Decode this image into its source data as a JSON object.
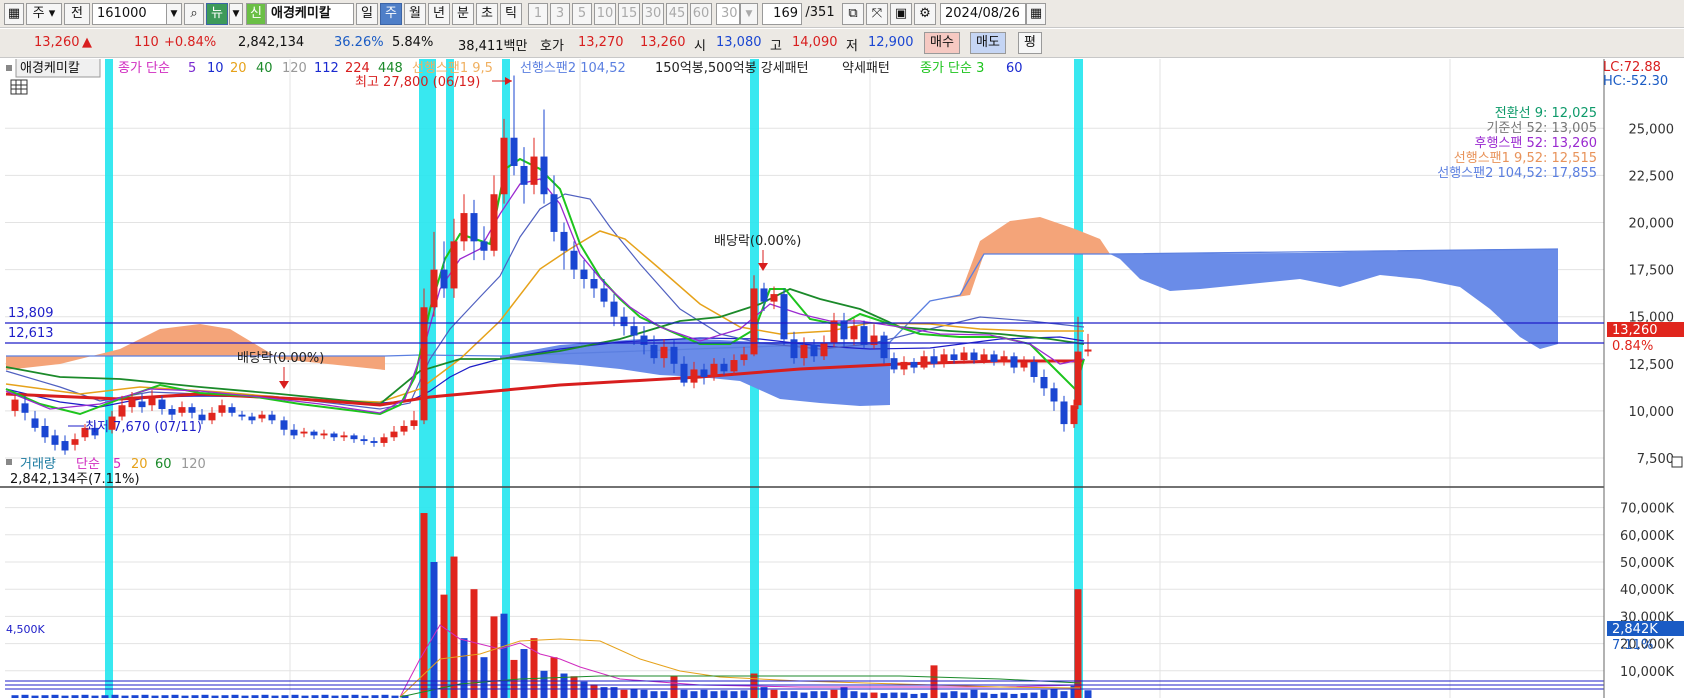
{
  "toolbar": {
    "market_label": "주",
    "prev_label": "전",
    "code": "161000",
    "news_label": "뉴",
    "credit_label": "신",
    "stock_name": "애경케미칼",
    "period_day": "일",
    "period_week": "주",
    "period_month": "월",
    "period_year": "년",
    "period_minute": "분",
    "period_second": "초",
    "period_tick": "틱",
    "intervals": [
      "1",
      "3",
      "5",
      "10",
      "15",
      "30",
      "45",
      "60"
    ],
    "interval_value": "30",
    "count_value": "169",
    "count_total": "/351",
    "date": "2024/08/26"
  },
  "quote": {
    "price": "13,260",
    "change_arrow": "▲",
    "change": "110",
    "change_pct": "+0.84%",
    "volume": "2,842,134",
    "ratio1": "36.26%",
    "ratio2": "5.84%",
    "trade_value": "38,411백만",
    "hoga_label": "호가",
    "ask": "13,270",
    "bid": "13,260",
    "open_label": "시",
    "open": "13,080",
    "high_label": "고",
    "high": "14,090",
    "low_label": "저",
    "low": "12,900",
    "buy_label": "매수",
    "sell_label": "매도",
    "eval_label": "평"
  },
  "price_panel": {
    "name": "애경케미칼",
    "ma_title": "종가 단순",
    "ma_periods": [
      "5",
      "10",
      "20",
      "40",
      "120",
      "112",
      "224",
      "448"
    ],
    "span1_label": "선행스팬1 9,5",
    "span2_label": "선행스팬2 104,52",
    "pattern_label": "150억봉,500억봉 강세패턴",
    "weak_label": "약세패턴",
    "ma3_label": "종가 단순 3",
    "ma3_extra": "60",
    "lc": "LC:72.88",
    "hc": "HC:-52.30",
    "legend": [
      {
        "text": "전환선 9: 12,025",
        "color": "#0e9a6a"
      },
      {
        "text": "기준선 52: 13,005",
        "color": "#777777"
      },
      {
        "text": "후행스팬 52: 13,260",
        "color": "#9a2ad0"
      },
      {
        "text": "선행스팬1 9,52: 12,515",
        "color": "#e8935a"
      },
      {
        "text": "선행스팬2 104,52: 17,855",
        "color": "#5b7fe0"
      }
    ],
    "hline1": "13,809",
    "hline2": "12,613",
    "current_label": "13,260",
    "pct_label": "0.84%",
    "max_label": "최고 27,800 (06/19)",
    "min_label": "최저 7,670 (07/11)",
    "div1": "배당락(0.00%)",
    "div2": "배당락(0.00%)",
    "y_ticks": [
      "25,000",
      "22,500",
      "20,000",
      "17,500",
      "15,000",
      "12,500",
      "10,000",
      "7,500"
    ]
  },
  "volume_panel": {
    "title": "거래량",
    "ma_title": "단순",
    "ma_periods": [
      "5",
      "20",
      "60",
      "120"
    ],
    "vol_text": "2,842,134주(7.11%)",
    "left_marker": "4,500K",
    "current_label": "2,842K",
    "pct_label": "7.11%",
    "y_ticks": [
      "70,000K",
      "60,000K",
      "50,000K",
      "40,000K",
      "30,000K",
      "20,000K",
      "10,000K"
    ]
  },
  "colors": {
    "up": "#e0251d",
    "down": "#1a46d2",
    "highlight": "#22e5ee",
    "cloud_up": "#f4a479",
    "cloud_down": "#6a8ce8"
  }
}
